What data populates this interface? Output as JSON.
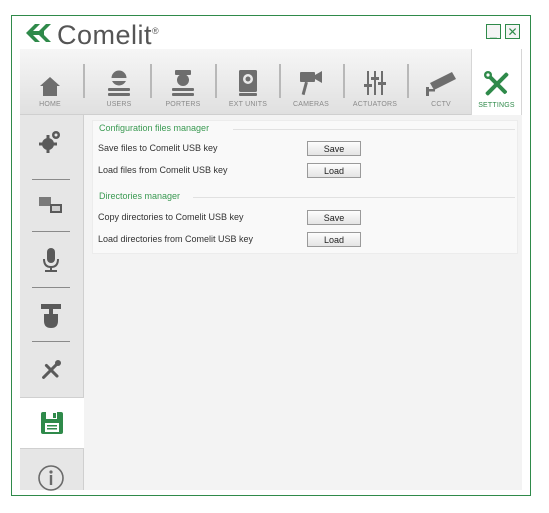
{
  "app": {
    "brand": "Comelit",
    "brand_mark": "®",
    "minimize_label": "_",
    "close_label": "✕",
    "accent_color": "#2f8a4a"
  },
  "tabs": [
    {
      "id": "home",
      "label": "HOME",
      "icon": "home-icon"
    },
    {
      "id": "users",
      "label": "USERS",
      "icon": "user-icon"
    },
    {
      "id": "porters",
      "label": "PORTERS",
      "icon": "porter-icon"
    },
    {
      "id": "ext-units",
      "label": "EXT UNITS",
      "icon": "entrance-panel-icon"
    },
    {
      "id": "cameras",
      "label": "CAMERAS",
      "icon": "camera-icon"
    },
    {
      "id": "actuators",
      "label": "ACTUATORS",
      "icon": "sliders-icon"
    },
    {
      "id": "cctv",
      "label": "CCTV",
      "icon": "cctv-icon"
    },
    {
      "id": "settings",
      "label": "SETTINGS",
      "icon": "tools-icon",
      "active": true
    }
  ],
  "sidebar": {
    "items": [
      {
        "id": "configuration",
        "icon": "gears-icon"
      },
      {
        "id": "devices",
        "icon": "monitors-icon"
      },
      {
        "id": "audio",
        "icon": "microphone-icon"
      },
      {
        "id": "touch",
        "icon": "touch-icon"
      },
      {
        "id": "tools",
        "icon": "tools-icon"
      },
      {
        "id": "usb-backup",
        "icon": "floppy-disk-icon",
        "active": true
      },
      {
        "id": "info",
        "icon": "info-icon"
      }
    ]
  },
  "config_manager": {
    "title": "Configuration files manager",
    "rows": [
      {
        "label": "Save files to Comelit USB key",
        "button": "Save"
      },
      {
        "label": "Load files from Comelit USB key",
        "button": "Load"
      }
    ]
  },
  "directories_manager": {
    "title": "Directories manager",
    "rows": [
      {
        "label": "Copy directories to Comelit USB key",
        "button": "Save"
      },
      {
        "label": "Load directories from Comelit USB key",
        "button": "Load"
      }
    ]
  }
}
